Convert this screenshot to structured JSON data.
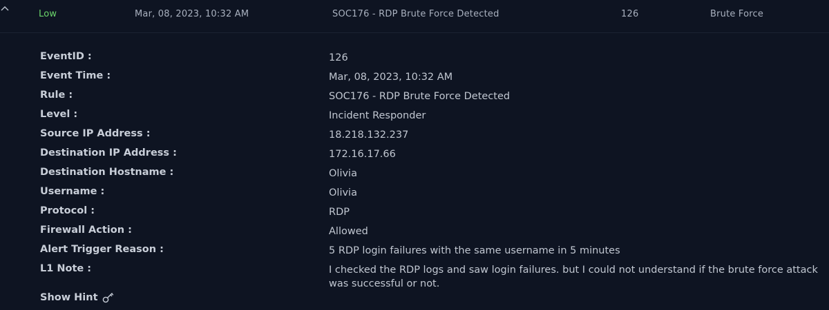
{
  "alert_row": {
    "severity": "Low",
    "date": "Mar, 08, 2023, 10:32 AM",
    "rule": "SOC176 - RDP Brute Force Detected",
    "event_id": "126",
    "type": "Brute Force"
  },
  "details": [
    {
      "label": "EventID :",
      "value": "126"
    },
    {
      "label": "Event Time :",
      "value": "Mar, 08, 2023, 10:32 AM"
    },
    {
      "label": "Rule :",
      "value": "SOC176 - RDP Brute Force Detected"
    },
    {
      "label": "Level :",
      "value": "Incident Responder"
    },
    {
      "label": "Source IP Address :",
      "value": "18.218.132.237"
    },
    {
      "label": "Destination IP Address :",
      "value": "172.16.17.66"
    },
    {
      "label": "Destination Hostname :",
      "value": "Olivia"
    },
    {
      "label": "Username :",
      "value": "Olivia"
    },
    {
      "label": "Protocol :",
      "value": "RDP"
    },
    {
      "label": "Firewall Action :",
      "value": "Allowed"
    },
    {
      "label": "Alert Trigger Reason :",
      "value": "5 RDP login failures with the same username in 5 minutes"
    },
    {
      "label": "L1 Note :",
      "value": "I checked the RDP logs and saw login failures. but I could not understand if the brute force attack was successful or not."
    }
  ],
  "hint": {
    "label": "Show Hint",
    "icon": "key-icon"
  },
  "colors": {
    "background": "#0e1422",
    "severity_low": "#6bd66b"
  }
}
